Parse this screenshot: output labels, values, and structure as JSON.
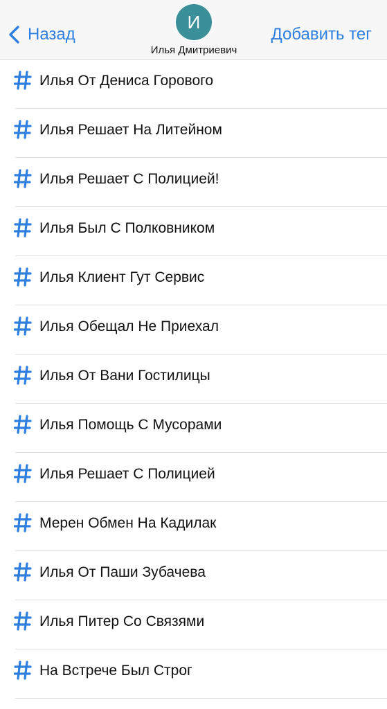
{
  "header": {
    "back_label": "Назад",
    "add_tag_label": "Добавить тег",
    "avatar_initial": "И",
    "contact_name": "Илья Дмитриевич",
    "accent_color": "#2f7fe0",
    "avatar_color": "#3a8f98"
  },
  "tags": [
    {
      "label": "Илья От Дениса Горового",
      "icon": "hashtag-icon"
    },
    {
      "label": "Илья Решает На Литейном",
      "icon": "hashtag-icon"
    },
    {
      "label": "Илья Решает С Полицией!",
      "icon": "hashtag-icon"
    },
    {
      "label": "Илья Был С Полковником",
      "icon": "hashtag-icon"
    },
    {
      "label": "Илья Клиент Гут Сервис",
      "icon": "hashtag-icon"
    },
    {
      "label": "Илья Обещал Не Приехал",
      "icon": "hashtag-icon"
    },
    {
      "label": "Илья От Вани Гостилицы",
      "icon": "hashtag-icon"
    },
    {
      "label": "Илья Помощь С Мусорами",
      "icon": "hashtag-icon"
    },
    {
      "label": "Илья Решает С Полицией",
      "icon": "hashtag-icon"
    },
    {
      "label": "Мерен Обмен На Кадилак",
      "icon": "hashtag-icon"
    },
    {
      "label": "Илья От Паши Зубачева",
      "icon": "hashtag-icon"
    },
    {
      "label": "Илья Питер Со Связями",
      "icon": "hashtag-icon"
    },
    {
      "label": "На Встрече Был Строг",
      "icon": "hashtag-icon"
    }
  ]
}
